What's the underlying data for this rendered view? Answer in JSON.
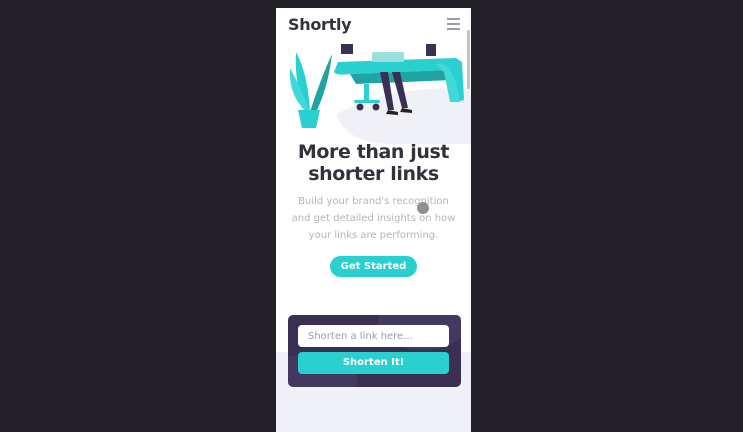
{
  "header": {
    "logo": "Shortly",
    "menu_icon": "hamburger-menu-icon"
  },
  "hero": {
    "illustration": "person-working-at-desk-illustration",
    "title": "More than just shorter links",
    "subtitle": "Build your brand's recognition and get detailed insights on how your links are performing.",
    "cta_label": "Get Started"
  },
  "shorten": {
    "placeholder": "Shorten a link here...",
    "value": "",
    "button_label": "Shorten It!"
  },
  "colors": {
    "accent": "#2acfcf",
    "dark_violet": "#3b3054",
    "heading": "#34313d",
    "body_text": "#b5b3bb",
    "outer_background": "#232127"
  }
}
